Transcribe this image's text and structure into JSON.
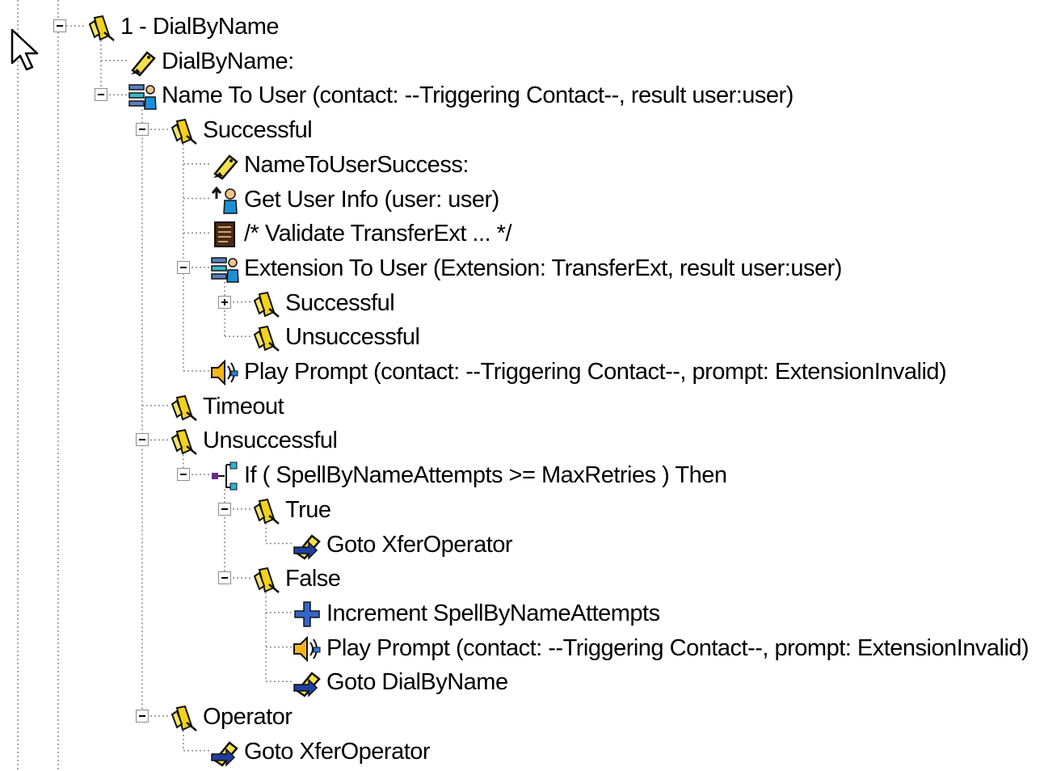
{
  "tree": {
    "nodes": [
      {
        "level": 0,
        "icon": "step-label-icon",
        "label": "1 - DialByName",
        "toggle": "minus"
      },
      {
        "level": 1,
        "icon": "label-tag-icon",
        "label": "DialByName:",
        "toggle": null
      },
      {
        "level": 1,
        "icon": "user-lookup-icon",
        "label": "Name To User (contact: --Triggering Contact--, result user:user)",
        "toggle": "minus"
      },
      {
        "level": 2,
        "icon": "step-label-icon",
        "label": "Successful",
        "toggle": "minus"
      },
      {
        "level": 3,
        "icon": "label-tag-icon",
        "label": "NameToUserSuccess:",
        "toggle": null
      },
      {
        "level": 3,
        "icon": "user-info-icon",
        "label": "Get User Info (user: user)",
        "toggle": null
      },
      {
        "level": 3,
        "icon": "comment-document-icon",
        "label": "/* Validate TransferExt ... */",
        "toggle": null
      },
      {
        "level": 3,
        "icon": "user-lookup-icon",
        "label": "Extension To User (Extension: TransferExt, result user:user)",
        "toggle": "minus"
      },
      {
        "level": 4,
        "icon": "step-label-icon",
        "label": "Successful",
        "toggle": "plus"
      },
      {
        "level": 4,
        "icon": "step-label-icon",
        "label": "Unsuccessful",
        "toggle": null
      },
      {
        "level": 3,
        "icon": "speaker-icon",
        "label": "Play Prompt (contact: --Triggering Contact--, prompt: ExtensionInvalid)",
        "toggle": null
      },
      {
        "level": 2,
        "icon": "step-label-icon",
        "label": "Timeout",
        "toggle": null
      },
      {
        "level": 2,
        "icon": "step-label-icon",
        "label": "Unsuccessful",
        "toggle": "minus"
      },
      {
        "level": 3,
        "icon": "if-branch-icon",
        "label": "If ( SpellByNameAttempts >= MaxRetries ) Then",
        "toggle": "minus"
      },
      {
        "level": 4,
        "icon": "step-label-icon",
        "label": "True",
        "toggle": "minus"
      },
      {
        "level": 5,
        "icon": "goto-icon",
        "label": "Goto XferOperator",
        "toggle": null
      },
      {
        "level": 4,
        "icon": "step-label-icon",
        "label": "False",
        "toggle": "minus"
      },
      {
        "level": 5,
        "icon": "increment-icon",
        "label": "Increment SpellByNameAttempts",
        "toggle": null
      },
      {
        "level": 5,
        "icon": "speaker-icon",
        "label": "Play Prompt (contact: --Triggering Contact--, prompt: ExtensionInvalid)",
        "toggle": null
      },
      {
        "level": 5,
        "icon": "goto-icon",
        "label": "Goto DialByName",
        "toggle": null
      },
      {
        "level": 2,
        "icon": "step-label-icon",
        "label": "Operator",
        "toggle": "minus"
      },
      {
        "level": 3,
        "icon": "goto-icon",
        "label": "Goto XferOperator",
        "toggle": null
      }
    ]
  },
  "cursor": {
    "icon": "mouse-pointer-icon"
  }
}
